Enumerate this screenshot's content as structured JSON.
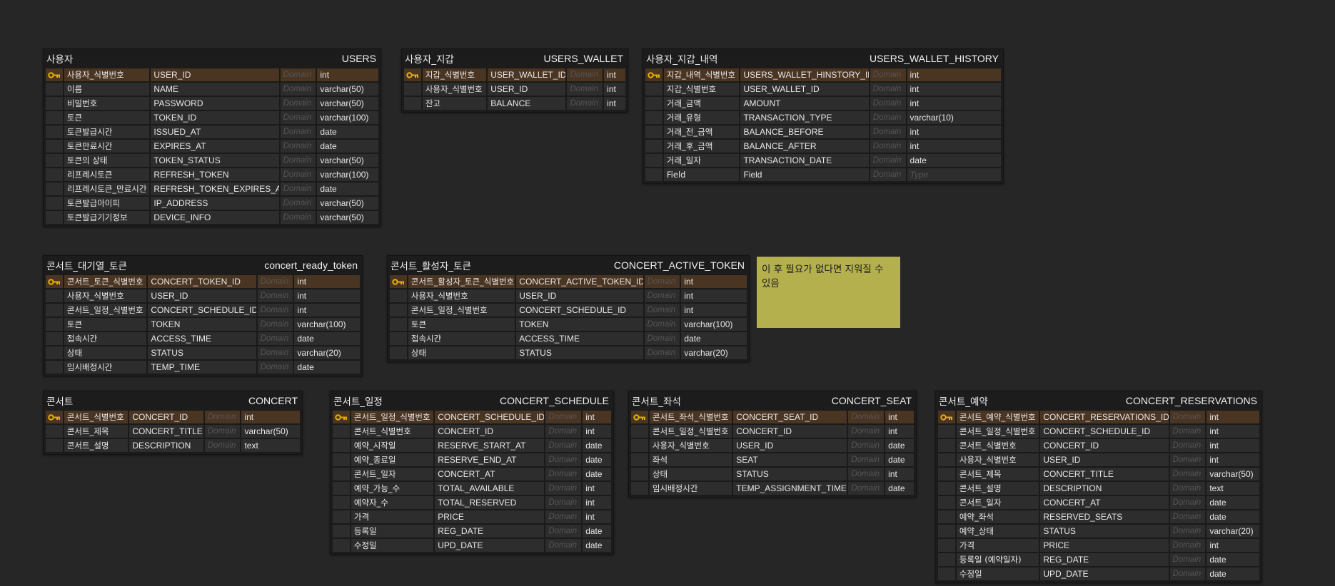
{
  "domain_colors": {
    "background": "#262626",
    "table": "#1c1c1c",
    "cell": "#2d2d2d",
    "pk_row": "#4a3422",
    "key_icon": "#e0b000",
    "note": "#b5b04e"
  },
  "domain_placeholder": "Domain",
  "type_placeholder": "Type",
  "note": {
    "text": "이 후 필요가 없다면 지워질 수 있음"
  },
  "tables": [
    {
      "kr": "사용자",
      "en": "USERS",
      "rows": [
        {
          "kr": "사용자_식별번호",
          "en": "USER_ID",
          "type": "int",
          "pk": true
        },
        {
          "kr": "이름",
          "en": "NAME",
          "type": "varchar(50)"
        },
        {
          "kr": "비밀번호",
          "en": "PASSWORD",
          "type": "varchar(50)"
        },
        {
          "kr": "토큰",
          "en": "TOKEN_ID",
          "type": "varchar(100)"
        },
        {
          "kr": "토큰발급시간",
          "en": "ISSUED_AT",
          "type": "date"
        },
        {
          "kr": "토큰만료시간",
          "en": "EXPIRES_AT",
          "type": "date"
        },
        {
          "kr": "토큰의 상태",
          "en": "TOKEN_STATUS",
          "type": "varchar(50)"
        },
        {
          "kr": "리프레시토큰",
          "en": "REFRESH_TOKEN",
          "type": "varchar(100)"
        },
        {
          "kr": "리프레시토큰_만료시간",
          "en": "REFRESH_TOKEN_EXPIRES_AT",
          "type": "date"
        },
        {
          "kr": "토큰발급아이피",
          "en": "IP_ADDRESS",
          "type": "varchar(50)"
        },
        {
          "kr": "토큰발급기기정보",
          "en": "DEVICE_INFO",
          "type": "varchar(50)"
        }
      ]
    },
    {
      "kr": "사용자_지갑",
      "en": "USERS_WALLET",
      "rows": [
        {
          "kr": "지갑_식별번호",
          "en": "USER_WALLET_ID",
          "type": "int",
          "pk": true
        },
        {
          "kr": "사용자_식별번호",
          "en": "USER_ID",
          "type": "int"
        },
        {
          "kr": "잔고",
          "en": "BALANCE",
          "type": "int"
        }
      ]
    },
    {
      "kr": "사용자_지갑_내역",
      "en": "USERS_WALLET_HISTORY",
      "rows": [
        {
          "kr": "지갑_내역_식별번호",
          "en": "USERS_WALLET_HINSTORY_ID",
          "type": "int",
          "pk": true
        },
        {
          "kr": "지갑_식별번호",
          "en": "USER_WALLET_ID",
          "type": "int"
        },
        {
          "kr": "거래_금액",
          "en": "AMOUNT",
          "type": "int"
        },
        {
          "kr": "거래_유형",
          "en": "TRANSACTION_TYPE",
          "type": "varchar(10)"
        },
        {
          "kr": "거래_전_금액",
          "en": "BALANCE_BEFORE",
          "type": "int"
        },
        {
          "kr": "거래_후_금액",
          "en": "BALANCE_AFTER",
          "type": "int"
        },
        {
          "kr": "거래_일자",
          "en": "TRANSACTION_DATE",
          "type": "date"
        },
        {
          "kr": "Field",
          "en": "Field",
          "type": ""
        }
      ]
    },
    {
      "kr": "콘서트_대기열_토큰",
      "en": "concert_ready_token",
      "rows": [
        {
          "kr": "콘서트_토큰_식별번호",
          "en": "CONCERT_TOKEN_ID",
          "type": "int",
          "pk": true
        },
        {
          "kr": "사용자_식별번호",
          "en": "USER_ID",
          "type": "int"
        },
        {
          "kr": "콘서트_일정_식별번호",
          "en": "CONCERT_SCHEDULE_ID",
          "type": "int"
        },
        {
          "kr": "토큰",
          "en": "TOKEN",
          "type": "varchar(100)"
        },
        {
          "kr": "접속시간",
          "en": "ACCESS_TIME",
          "type": "date"
        },
        {
          "kr": "상태",
          "en": "STATUS",
          "type": "varchar(20)"
        },
        {
          "kr": "임시배정시간",
          "en": "TEMP_TIME",
          "type": "date"
        }
      ]
    },
    {
      "kr": "콘서트_활성자_토큰",
      "en": "CONCERT_ACTIVE_TOKEN",
      "rows": [
        {
          "kr": "콘서트_활성자_토큰_식별번호",
          "en": "CONCERT_ACTIVE_TOKEN_ID",
          "type": "int",
          "pk": true
        },
        {
          "kr": "사용자_식별번호",
          "en": "USER_ID",
          "type": "int"
        },
        {
          "kr": "콘서트_일정_식별번호",
          "en": "CONCERT_SCHEDULE_ID",
          "type": "int"
        },
        {
          "kr": "토큰",
          "en": "TOKEN",
          "type": "varchar(100)"
        },
        {
          "kr": "접속시간",
          "en": "ACCESS_TIME",
          "type": "date"
        },
        {
          "kr": "상태",
          "en": "STATUS",
          "type": "varchar(20)"
        }
      ]
    },
    {
      "kr": "콘서트",
      "en": "CONCERT",
      "rows": [
        {
          "kr": "콘서트_식별번호",
          "en": "CONCERT_ID",
          "type": "int",
          "pk": true
        },
        {
          "kr": "콘서트_제목",
          "en": "CONCERT_TITLE",
          "type": "varchar(50)"
        },
        {
          "kr": "콘서트_설명",
          "en": "DESCRIPTION",
          "type": "text"
        }
      ]
    },
    {
      "kr": "콘서트_일정",
      "en": "CONCERT_SCHEDULE",
      "rows": [
        {
          "kr": "콘서트_일정_식별번호",
          "en": "CONCERT_SCHEDULE_ID",
          "type": "int",
          "pk": true
        },
        {
          "kr": "콘서트_식별번호",
          "en": "CONCERT_ID",
          "type": "int"
        },
        {
          "kr": "예약_시작일",
          "en": "RESERVE_START_AT",
          "type": "date"
        },
        {
          "kr": "예약_종료일",
          "en": "RESERVE_END_AT",
          "type": "date"
        },
        {
          "kr": "콘서트_일자",
          "en": "CONCERT_AT",
          "type": "date"
        },
        {
          "kr": "예약_가능_수",
          "en": "TOTAL_AVAILABLE",
          "type": "int"
        },
        {
          "kr": "예약자_수",
          "en": "TOTAL_RESERVED",
          "type": "int"
        },
        {
          "kr": "가격",
          "en": "PRICE",
          "type": "int"
        },
        {
          "kr": "등록일",
          "en": "REG_DATE",
          "type": "date"
        },
        {
          "kr": "수정일",
          "en": "UPD_DATE",
          "type": "date"
        }
      ]
    },
    {
      "kr": "콘서트_좌석",
      "en": "CONCERT_SEAT",
      "rows": [
        {
          "kr": "콘서트_좌석_식별번호",
          "en": "CONCERT_SEAT_ID",
          "type": "int",
          "pk": true
        },
        {
          "kr": "콘서트_일정_식별번호",
          "en": "CONCERT_ID",
          "type": "int"
        },
        {
          "kr": "사용자_식별번호",
          "en": "USER_ID",
          "type": "date"
        },
        {
          "kr": "좌석",
          "en": "SEAT",
          "type": "date"
        },
        {
          "kr": "상태",
          "en": "STATUS",
          "type": "int"
        },
        {
          "kr": "임시배정시간",
          "en": "TEMP_ASSIGNMENT_TIME",
          "type": "date"
        }
      ]
    },
    {
      "kr": "콘서트_예약",
      "en": "CONCERT_RESERVATIONS",
      "rows": [
        {
          "kr": "콘서트_예약_식별번호",
          "en": "CONCERT_RESERVATIONS_ID",
          "type": "int",
          "pk": true
        },
        {
          "kr": "콘서트_일정_식별번호",
          "en": "CONCERT_SCHEDULE_ID",
          "type": "int"
        },
        {
          "kr": "콘서트_식별번호",
          "en": "CONCERT_ID",
          "type": "int"
        },
        {
          "kr": "사용자_식별번호",
          "en": "USER_ID",
          "type": "int"
        },
        {
          "kr": "콘서트_제목",
          "en": "CONCERT_TITLE",
          "type": "varchar(50)"
        },
        {
          "kr": "콘서트_설명",
          "en": "DESCRIPTION",
          "type": "text"
        },
        {
          "kr": "콘서트_일자",
          "en": "CONCERT_AT",
          "type": "date"
        },
        {
          "kr": "예약_좌석",
          "en": "RESERVED_SEATS",
          "type": "date"
        },
        {
          "kr": "예약_상태",
          "en": "STATUS",
          "type": "varchar(20)"
        },
        {
          "kr": "가격",
          "en": "PRICE",
          "type": "int"
        },
        {
          "kr": "등록일 (예약일자)",
          "en": "REG_DATE",
          "type": "date"
        },
        {
          "kr": "수정일",
          "en": "UPD_DATE",
          "type": "date"
        }
      ]
    }
  ]
}
